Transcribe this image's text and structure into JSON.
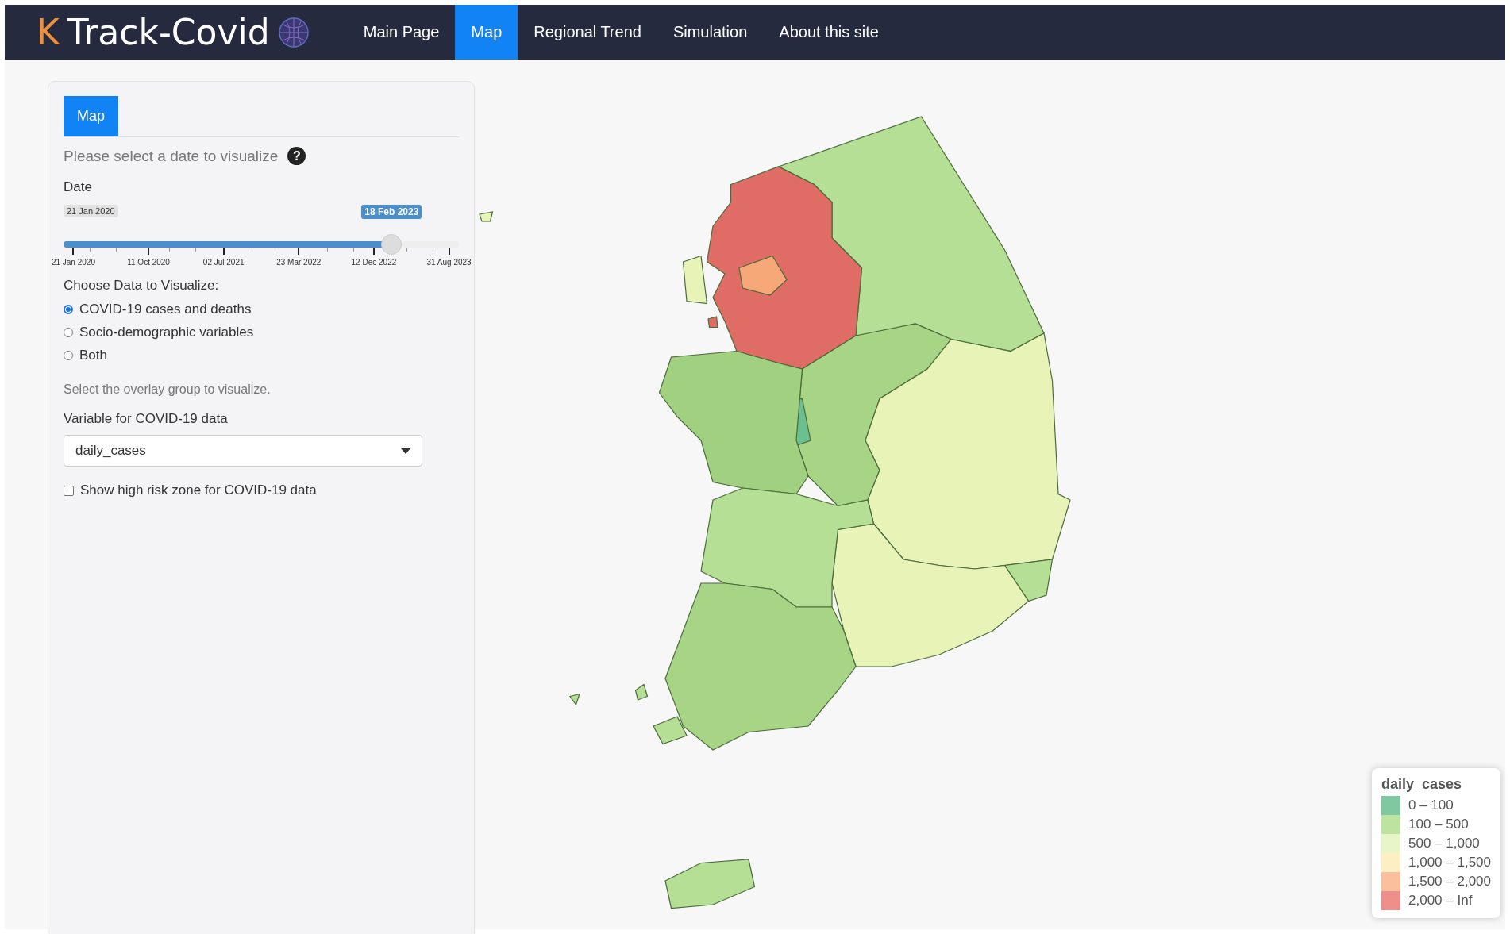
{
  "header": {
    "logo_mark": "K",
    "logo_text": "Track-Covid",
    "nav": [
      {
        "label": "Main Page",
        "selected": false
      },
      {
        "label": "Map",
        "selected": true
      },
      {
        "label": "Regional Trend",
        "selected": false
      },
      {
        "label": "Simulation",
        "selected": false
      },
      {
        "label": "About this site",
        "selected": false
      }
    ]
  },
  "sidebar": {
    "tabs": [
      {
        "label": "Map",
        "selected": true
      }
    ],
    "date_prompt": "Please select a date to visualize",
    "help_icon": "?",
    "date_slider": {
      "label": "Date",
      "min_label": "21 Jan 2020",
      "value_label": "18 Feb 2023",
      "level": 0.83,
      "ticks": [
        "21 Jan 2020",
        "11 Oct 2020",
        "02 Jul 2021",
        "23 Mar 2022",
        "12 Dec 2022",
        "31 Aug 2023"
      ]
    },
    "data_choice": {
      "label": "Choose Data to Visualize:",
      "options": [
        {
          "label": "COVID-19 cases and deaths",
          "selected": true
        },
        {
          "label": "Socio-demographic variables",
          "selected": false
        },
        {
          "label": "Both",
          "selected": false
        }
      ]
    },
    "overlay_hint": "Select the overlay group to visualize.",
    "variable_select": {
      "label": "Variable for COVID-19 data",
      "value": "daily_cases"
    },
    "high_risk": {
      "label": "Show high risk zone for COVID-19 data",
      "checked": false
    }
  },
  "legend": {
    "title": "daily_cases",
    "items": [
      {
        "label": "0 – 100",
        "color": "#80c8a0"
      },
      {
        "label": "100 – 500",
        "color": "#bde3a0"
      },
      {
        "label": "500 – 1,000",
        "color": "#e8f5c8"
      },
      {
        "label": "1,000 – 1,500",
        "color": "#fdefc4"
      },
      {
        "label": "1,500 – 2,000",
        "color": "#fcbf9e"
      },
      {
        "label": "2,000 – Inf",
        "color": "#ee8f8c"
      }
    ]
  }
}
